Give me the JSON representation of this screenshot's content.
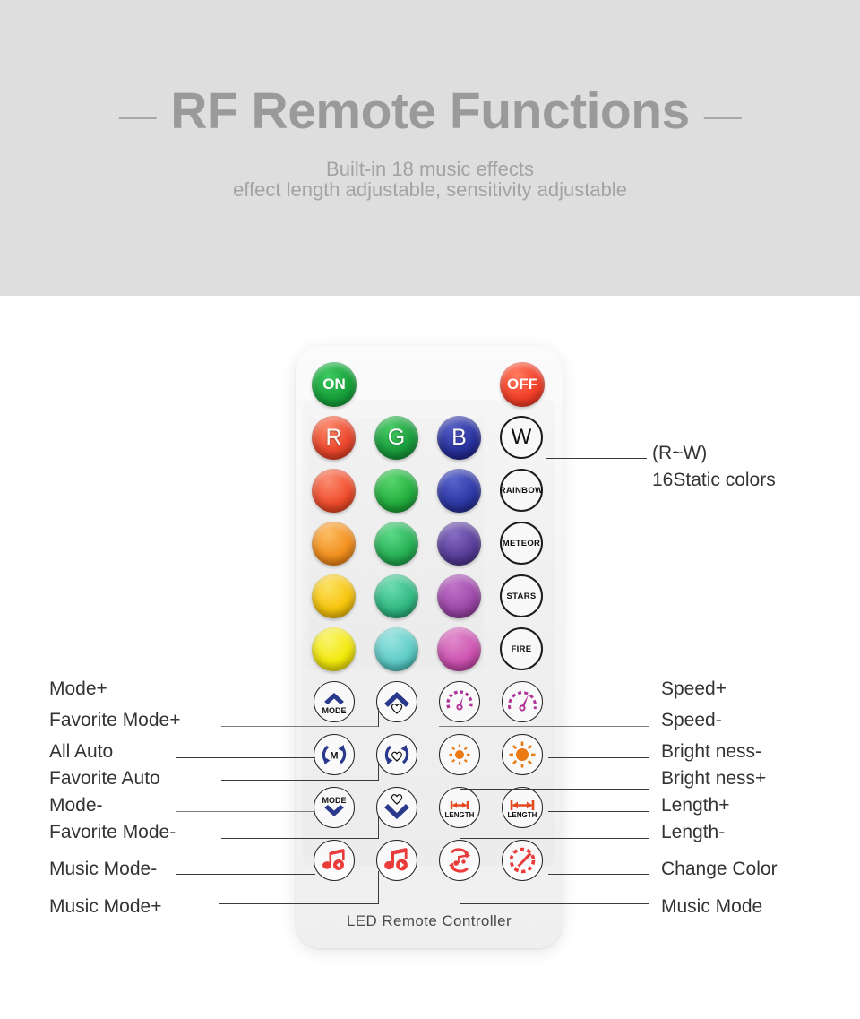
{
  "header": {
    "title": "RF Remote Functions",
    "dash_left": "—",
    "dash_right": "—",
    "subtitle_line1": "Built-in 18 music effects",
    "subtitle_line2": "effect length adjustable, sensitivity adjustable",
    "background_color": "#dededf",
    "title_color": "#9a9a9a"
  },
  "remote": {
    "brand_text": "LED Remote Controller",
    "power": {
      "on_label": "ON",
      "on_color": "#17a03a",
      "off_label": "OFF",
      "off_color": "#f1402a"
    },
    "rgbw_row": [
      {
        "label": "R",
        "name": "red-button",
        "color": "#f04a2e"
      },
      {
        "label": "G",
        "name": "green-button",
        "color": "#1ba23f"
      },
      {
        "label": "B",
        "name": "blue-button",
        "color": "#2a32a0"
      },
      {
        "label": "W",
        "name": "white-button",
        "color": "#fcfcfc"
      }
    ],
    "color_grid": [
      {
        "row": 1,
        "red": "#f4502f",
        "green": "#24b23f",
        "blue": "#2f39a8",
        "effect": "RAINBOW"
      },
      {
        "row": 2,
        "red": "#f79320",
        "green": "#28b558",
        "blue": "#5b3f9d",
        "effect": "METEOR"
      },
      {
        "row": 3,
        "red": "#fbc90e",
        "green": "#33bd85",
        "blue": "#a14aad",
        "effect": "STARS"
      },
      {
        "row": 4,
        "red": "#f7ed0c",
        "green": "#62d0cb",
        "blue": "#d055b4",
        "effect": "FIRE"
      }
    ],
    "function_rows": [
      {
        "row": 1,
        "buttons": [
          {
            "name": "mode-up-button",
            "icon": "chevron-up-mode-icon",
            "text": "MODE",
            "color": "#2b3a8f"
          },
          {
            "name": "favorite-mode-up-button",
            "icon": "chevron-up-heart-icon",
            "text": "",
            "color": "#2b3a8f"
          },
          {
            "name": "speed-up-button",
            "icon": "speed-gauge-small-icon",
            "text": "",
            "color": "#b3359a"
          },
          {
            "name": "speed-down-button",
            "icon": "speed-gauge-large-icon",
            "text": "",
            "color": "#b3359a"
          }
        ]
      },
      {
        "row": 2,
        "buttons": [
          {
            "name": "all-auto-button",
            "icon": "auto-loop-m-icon",
            "text": "M",
            "color": "#2b3a8f"
          },
          {
            "name": "favorite-auto-button",
            "icon": "auto-loop-heart-icon",
            "text": "",
            "color": "#2b3a8f"
          },
          {
            "name": "brightness-down-button",
            "icon": "sun-small-icon",
            "text": "",
            "color": "#f07c15"
          },
          {
            "name": "brightness-up-button",
            "icon": "sun-large-icon",
            "text": "",
            "color": "#f07c15"
          }
        ]
      },
      {
        "row": 3,
        "buttons": [
          {
            "name": "mode-down-button",
            "icon": "chevron-down-mode-icon",
            "text": "MODE",
            "color": "#2b3a8f"
          },
          {
            "name": "favorite-mode-down-button",
            "icon": "chevron-down-heart-icon",
            "text": "",
            "color": "#2b3a8f"
          },
          {
            "name": "length-up-button",
            "icon": "length-arrow-small-icon",
            "text": "LENGTH",
            "color": "#e8491f"
          },
          {
            "name": "length-down-button",
            "icon": "length-arrow-large-icon",
            "text": "LENGTH",
            "color": "#e8491f"
          }
        ]
      },
      {
        "row": 4,
        "buttons": [
          {
            "name": "music-mode-down-button",
            "icon": "music-note-prev-icon",
            "text": "",
            "color": "#ee3c3c"
          },
          {
            "name": "music-mode-up-button",
            "icon": "music-note-next-icon",
            "text": "",
            "color": "#ee3c3c"
          },
          {
            "name": "music-mode-button",
            "icon": "music-loop-icon",
            "text": "",
            "color": "#ee3c3c"
          },
          {
            "name": "change-color-button",
            "icon": "color-dropper-icon",
            "text": "",
            "color": "#ee3c3c"
          }
        ]
      }
    ]
  },
  "callouts": {
    "top_right": {
      "line1": "(R~W)",
      "line2": "16Static colors"
    },
    "left": [
      "Mode+",
      "Favorite Mode+",
      "All Auto",
      "Favorite Auto",
      "Mode-",
      "Favorite Mode-",
      "Music Mode-",
      "Music Mode+"
    ],
    "right": [
      "Speed+",
      "Speed-",
      "Bright ness-",
      "Bright ness+",
      "Length+",
      "Length-",
      "Change Color",
      "Music Mode"
    ]
  }
}
